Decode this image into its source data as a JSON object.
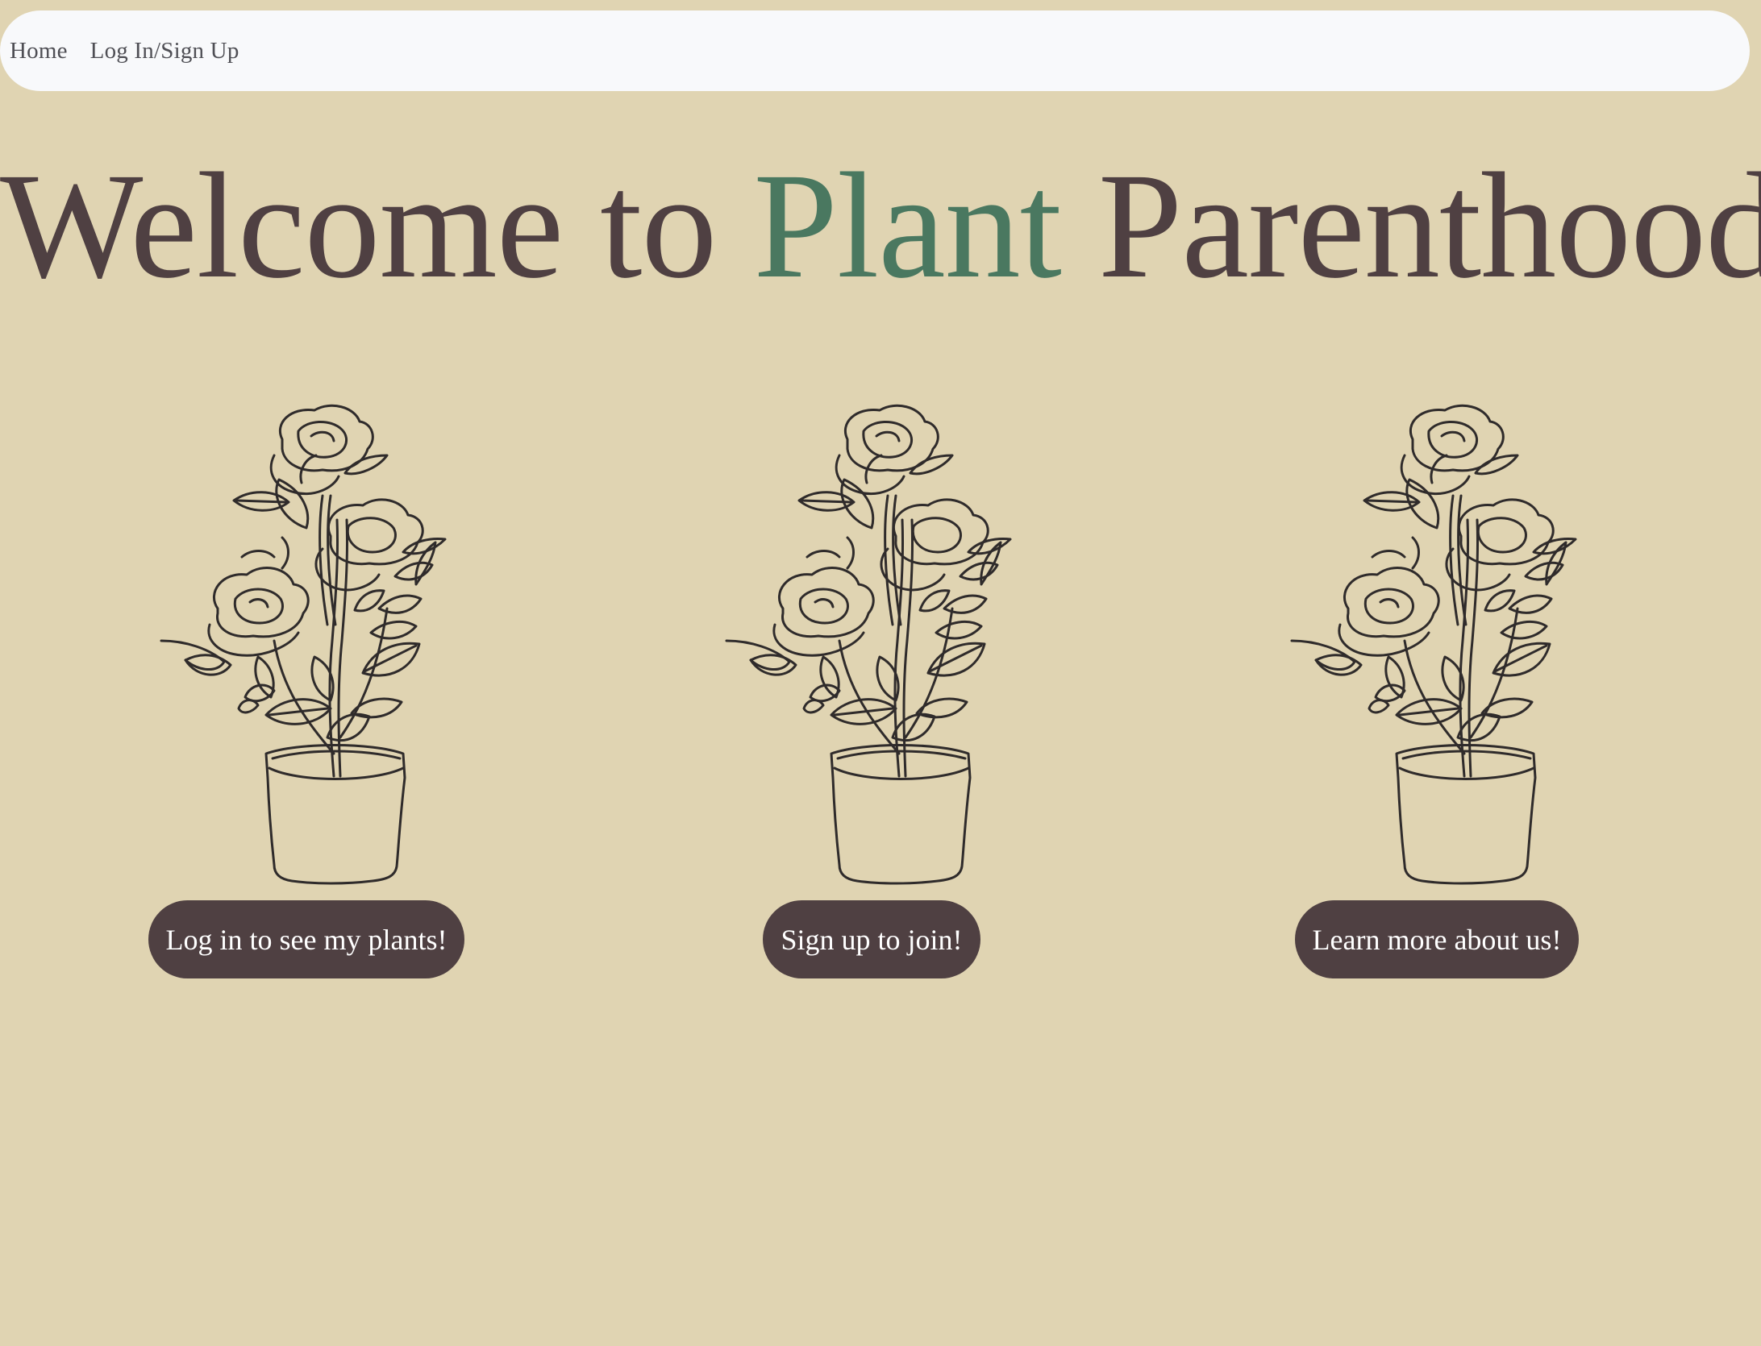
{
  "nav": {
    "items": [
      {
        "label": "Home"
      },
      {
        "label": "Log In/Sign Up"
      }
    ]
  },
  "hero": {
    "title_part1": "Welcome to ",
    "title_accent": "Plant",
    "title_part2": " Parenthood",
    "accent_color": "#4a7860",
    "text_color": "#4f4042"
  },
  "cards": [
    {
      "icon": "potted-rose-illustration",
      "button_label": "Log in to see my plants!"
    },
    {
      "icon": "potted-rose-illustration",
      "button_label": "Sign up to join!"
    },
    {
      "icon": "potted-rose-illustration",
      "button_label": "Learn more about us!"
    }
  ],
  "colors": {
    "background": "#e0d4b2",
    "navbar": "#f8f9fb",
    "button": "#4f4042"
  }
}
